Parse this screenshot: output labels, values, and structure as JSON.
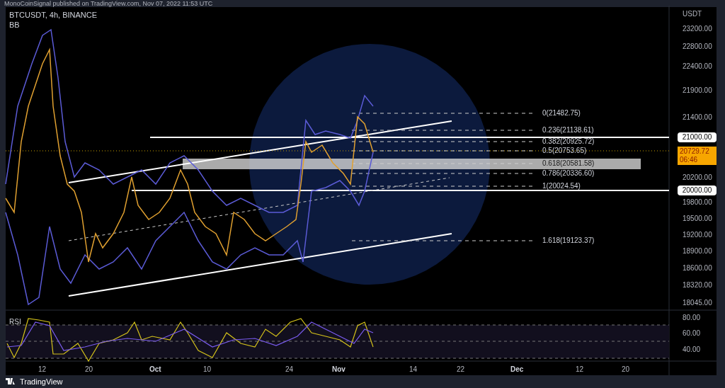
{
  "header": {
    "text": "MonoCoinSignal published on TradingView.com, Nov 07, 2022 11:53 UTC"
  },
  "legend": {
    "symbol": "BTCUSDT, 4h, BINANCE",
    "indicator": "BB"
  },
  "price_axis": {
    "currency": "USDT",
    "labels": [
      "23200.00",
      "22800.00",
      "22400.00",
      "21900.00",
      "21400.00",
      "20200.00",
      "19800.00",
      "19500.00",
      "19200.00",
      "18900.00",
      "18600.00",
      "18320.00",
      "18045.00"
    ],
    "level_tags": [
      "21000.00",
      "20000.00"
    ],
    "last_price": {
      "value": "20729.72",
      "countdown": "06:46"
    }
  },
  "fib_levels": [
    "0(21482.75)",
    "0.236(21138.61)",
    "0.382(20925.72)",
    "0.5(20753.65)",
    "0.618(20581.58)",
    "0.786(20336.60)",
    "1(20024.54)",
    "1.618(19123.37)"
  ],
  "rsi": {
    "label": "RSI",
    "axis_labels": [
      "80.00",
      "60.00",
      "40.00"
    ]
  },
  "time_axis": [
    {
      "label": "12",
      "kind": "day"
    },
    {
      "label": "20",
      "kind": "day"
    },
    {
      "label": "Oct",
      "kind": "month"
    },
    {
      "label": "10",
      "kind": "day"
    },
    {
      "label": "24",
      "kind": "day"
    },
    {
      "label": "Nov",
      "kind": "month"
    },
    {
      "label": "14",
      "kind": "day"
    },
    {
      "label": "22",
      "kind": "day"
    },
    {
      "label": "Dec",
      "kind": "month"
    },
    {
      "label": "12",
      "kind": "day"
    },
    {
      "label": "20",
      "kind": "day"
    }
  ],
  "footer": {
    "brand": "TradingView"
  }
}
